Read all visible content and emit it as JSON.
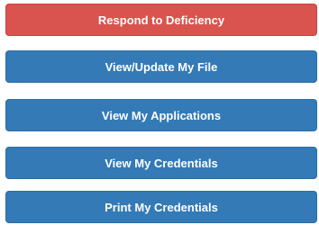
{
  "actions": {
    "respond_label": "Respond to Deficiency",
    "view_update_label": "View/Update My File",
    "applications_label": "View My Applications",
    "view_credentials_label": "View My Credentials",
    "print_credentials_label": "Print My Credentials"
  },
  "colors": {
    "danger": "#d9534f",
    "primary": "#337ab7"
  }
}
